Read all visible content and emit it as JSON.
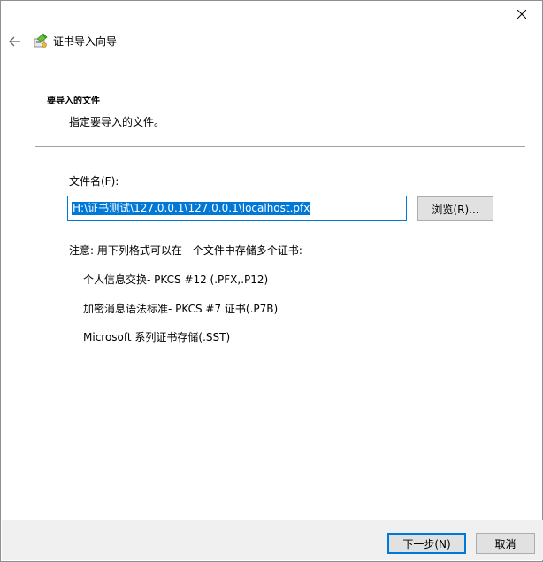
{
  "window": {
    "title": "证书导入向导"
  },
  "page": {
    "heading": "要导入的文件",
    "subheading": "指定要导入的文件。"
  },
  "file": {
    "label": "文件名(F):",
    "value": "H:\\证书测试\\127.0.0.1\\127.0.0.1\\localhost.pfx",
    "browse_label": "浏览(R)..."
  },
  "notes": {
    "intro": "注意: 用下列格式可以在一个文件中存储多个证书:",
    "formats": [
      "个人信息交换- PKCS #12 (.PFX,.P12)",
      "加密消息语法标准- PKCS #7 证书(.P7B)",
      "Microsoft 系列证书存储(.SST)"
    ]
  },
  "footer": {
    "next_label": "下一步(N)",
    "cancel_label": "取消"
  },
  "icons": {
    "close": "close-icon",
    "back": "back-arrow-icon",
    "wizard": "certificate-wizard-icon"
  },
  "colors": {
    "accent": "#0078d7",
    "footer_bg": "#f0f0f0",
    "button_bg": "#e1e1e1"
  }
}
